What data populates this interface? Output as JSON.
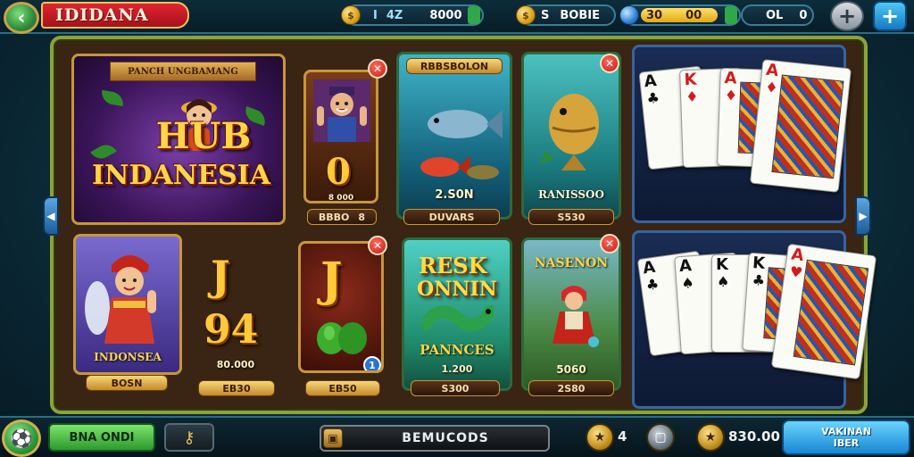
{
  "header": {
    "title": "IDIDANA",
    "back_icon": "back-arrow-icon",
    "resources": [
      {
        "label": "I",
        "value": "8000",
        "mid": "4Z",
        "icon": "gold-coin-icon"
      },
      {
        "label": "S",
        "value": "BOBIE",
        "icon": "gold-coin-icon"
      },
      {
        "label": "",
        "value": "30",
        "value2": "00",
        "icon": "blue-gem-icon"
      },
      {
        "label": "OL",
        "value": "0"
      }
    ],
    "settings_label": "+",
    "add_label": "+"
  },
  "tiles": {
    "hero": {
      "ribbon": "PANCH UNGBAMANG",
      "line1": "HUB",
      "line2": "INDANESIA"
    },
    "portrait_top": {
      "big": "0",
      "sub": "8 000",
      "plate": "BBBO",
      "plate2": "8"
    },
    "portrait_left": {
      "caption": "INDONSEA",
      "sub": "80.000",
      "plate": "BOSN"
    },
    "jackpot": {
      "letter": "J",
      "number": "94",
      "plate": "EB30"
    },
    "portrait_j": {
      "letter": "J",
      "plate": "EB50",
      "badge": "1"
    },
    "fish1": {
      "ribbon": "RBBSBOLON",
      "value": "2.S0N",
      "plate": "DUVARS"
    },
    "fish2": {
      "caption": "RANISSOO",
      "plate": "S530"
    },
    "resk": {
      "title1": "RESK",
      "title2": "ONNIN",
      "caption": "PANNCES",
      "value": "1.200",
      "plate": "S300"
    },
    "nasenon": {
      "title": "NASENON",
      "value": "5060",
      "plate": "2S80"
    }
  },
  "cards_top": [
    {
      "rank": "A",
      "suit": "♣",
      "color": "blk"
    },
    {
      "rank": "K",
      "suit": "♦",
      "color": "red"
    },
    {
      "rank": "A",
      "suit": "♦",
      "color": "red"
    },
    {
      "rank": "A",
      "suit": "♦",
      "color": "red"
    }
  ],
  "cards_bottom": [
    {
      "rank": "A",
      "suit": "♣",
      "color": "blk"
    },
    {
      "rank": "A",
      "suit": "♠",
      "color": "blk"
    },
    {
      "rank": "K",
      "suit": "♠",
      "color": "blk"
    },
    {
      "rank": "K",
      "suit": "♣",
      "color": "blk"
    },
    {
      "rank": "A",
      "suit": "♥",
      "color": "red"
    }
  ],
  "footer": {
    "green_button": "BNA ONDI",
    "center_label": "BEMUCODS",
    "stars_count": "4",
    "coins_value": "830.00",
    "blue_button_line1": "VAKINAN",
    "blue_button_line2": "IBER"
  }
}
